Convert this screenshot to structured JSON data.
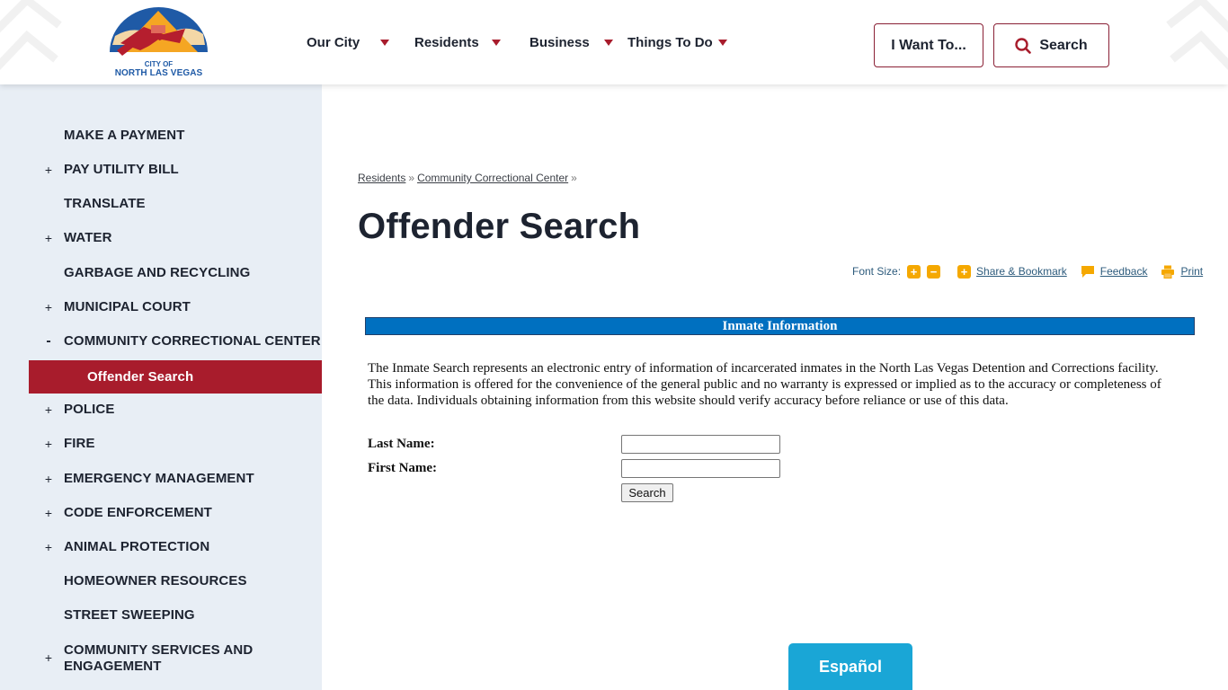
{
  "header": {
    "logo": {
      "line1": "CITY OF",
      "line2": "NORTH LAS VEGAS"
    },
    "nav": [
      {
        "label": "Our City",
        "icon": "caret-down-icon"
      },
      {
        "label": "Residents",
        "icon": "caret-down-icon"
      },
      {
        "label": "Business",
        "icon": "caret-down-icon"
      },
      {
        "label": "Things To Do",
        "icon": "caret-down-icon"
      }
    ],
    "i_want_to_label": "I Want To...",
    "search_label": "Search",
    "search_icon": "search-icon"
  },
  "sidebar": {
    "items": [
      {
        "label": "MAKE A PAYMENT",
        "toggle": ""
      },
      {
        "label": "PAY UTILITY BILL",
        "toggle": "+"
      },
      {
        "label": "TRANSLATE",
        "toggle": ""
      },
      {
        "label": "WATER",
        "toggle": "+"
      },
      {
        "label": "GARBAGE AND RECYCLING",
        "toggle": ""
      },
      {
        "label": "MUNICIPAL COURT",
        "toggle": "+"
      },
      {
        "label": "COMMUNITY CORRECTIONAL CENTER",
        "toggle": "-"
      },
      {
        "label": "Offender Search",
        "toggle": "",
        "active": true
      },
      {
        "label": "POLICE",
        "toggle": "+"
      },
      {
        "label": "FIRE",
        "toggle": "+"
      },
      {
        "label": "EMERGENCY MANAGEMENT",
        "toggle": "+"
      },
      {
        "label": "CODE ENFORCEMENT",
        "toggle": "+"
      },
      {
        "label": "ANIMAL PROTECTION",
        "toggle": "+"
      },
      {
        "label": "HOMEOWNER RESOURCES",
        "toggle": ""
      },
      {
        "label": "STREET SWEEPING",
        "toggle": ""
      },
      {
        "label": "COMMUNITY SERVICES AND ENGAGEMENT",
        "toggle": "+"
      }
    ],
    "active_color": "#a81c2c"
  },
  "breadcrumb": {
    "items": [
      "Residents",
      "Community Correctional Center"
    ],
    "separator": "»"
  },
  "page": {
    "title": "Offender Search"
  },
  "tools": {
    "font_size_label": "Font Size:",
    "increase_icon": "+",
    "decrease_icon": "−",
    "share_icon": "+",
    "share_label": "Share & Bookmark",
    "feedback_label": "Feedback",
    "print_label": "Print",
    "accent": "#f5a800"
  },
  "inmate": {
    "bar_title": "Inmate Information",
    "bar_color": "#0070c0",
    "disclaimer": "The Inmate Search represents an electronic entry of information of incarcerated inmates in the North Las Vegas Detention and Corrections facility. This information is offered for the convenience of the general public and no warranty is expressed or implied as to the accuracy or completeness of the data. Individuals obtaining information from this website should verify accuracy before reliance or use of this data.",
    "last_name_label": "Last Name:",
    "last_name_value": "",
    "first_name_label": "First Name:",
    "first_name_value": "",
    "search_button": "Search"
  },
  "language_button": "Español"
}
